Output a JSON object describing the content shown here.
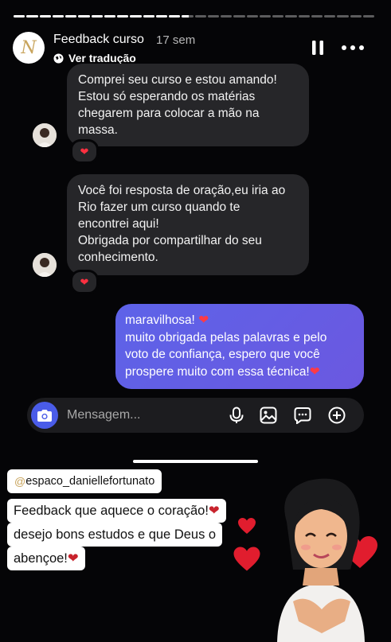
{
  "story": {
    "title": "Feedback curso",
    "time": "17 sem",
    "translate_label": "Ver tradução",
    "avatar_letter": "N",
    "progress_segments": [
      1,
      1,
      1,
      1,
      1,
      1,
      1,
      1,
      1,
      1,
      1,
      1,
      1,
      0.6,
      0,
      0,
      0,
      0,
      0,
      0,
      0,
      0,
      0,
      0,
      0,
      0,
      0,
      0
    ]
  },
  "messages": {
    "incoming_1": {
      "line1": "Comprei seu curso e estou amando!",
      "line2": "Estou só esperando os matérias",
      "line3": "chegarem para colocar a mão na",
      "line4": "massa.",
      "reaction": "❤"
    },
    "incoming_2": {
      "line1": "Você foi resposta de oração,eu iria ao",
      "line2": "Rio fazer um curso quando te",
      "line3": "encontrei aqui!",
      "line4": "Obrigada por compartilhar do seu",
      "line5": "conhecimento.",
      "reaction": "❤"
    },
    "outgoing": {
      "line1": "maravilhosa! ",
      "line2": "muito obrigada pelas palavras e pelo",
      "line3": "voto de confiança, espero que você",
      "line4": "prospere muito com essa técnica!",
      "heart": "❤"
    }
  },
  "composer": {
    "placeholder": "Mensagem..."
  },
  "overlay": {
    "mention": "espaco_daniellefortunato",
    "mention_at": "@",
    "caption_line1": "Feedback que aquece o coração!",
    "caption_line2": "desejo bons estudos e que Deus o",
    "caption_line3": "abençoe!",
    "heart": "❤"
  },
  "colors": {
    "background": "#050507",
    "incoming_bubble": "#262629",
    "outgoing_bubble": "#5d63e8",
    "heart": "#ff3040",
    "brand_gold": "#c8a45c"
  },
  "icons": [
    "globe-icon",
    "pause-icon",
    "more-icon",
    "camera-icon",
    "microphone-icon",
    "gallery-icon",
    "sticker-icon",
    "add-icon",
    "heart-icon"
  ]
}
